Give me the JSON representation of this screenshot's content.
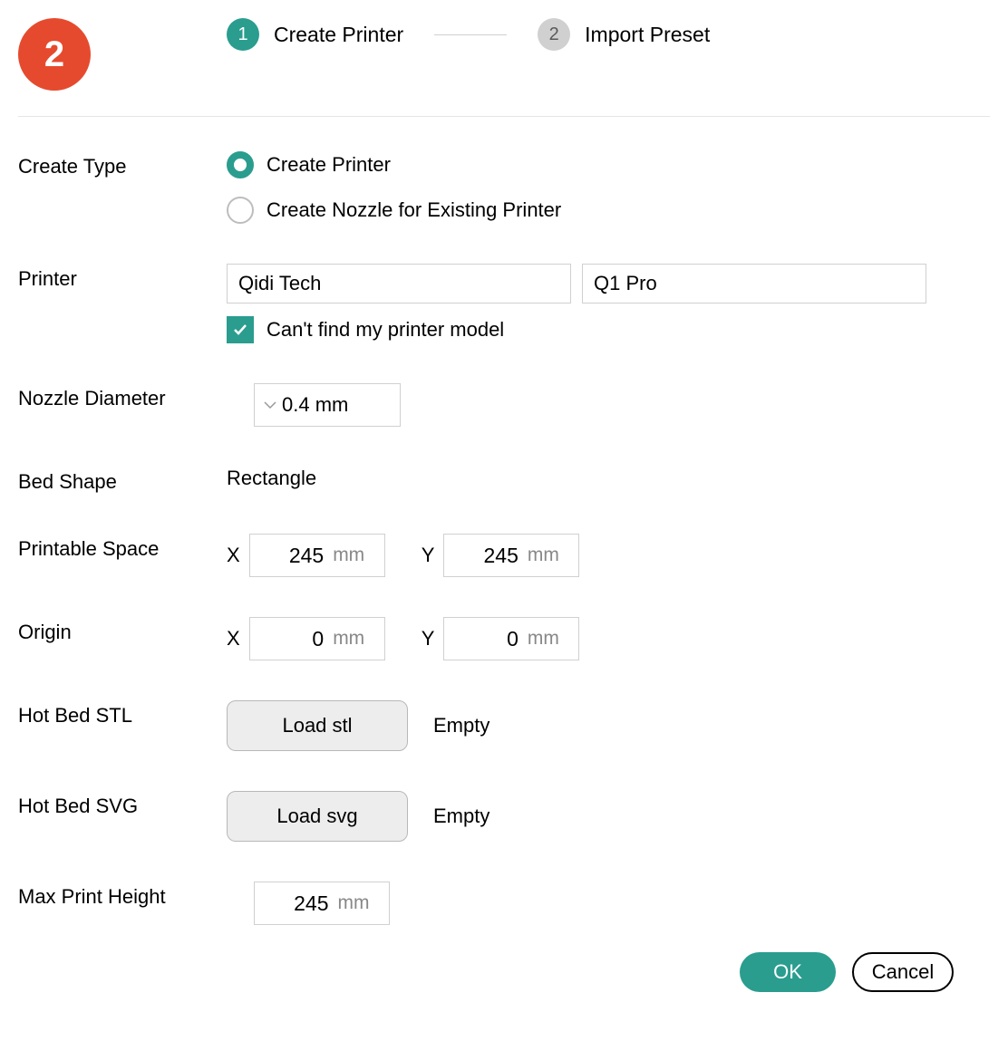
{
  "badge": "2",
  "steps": {
    "step1": {
      "num": "1",
      "label": "Create Printer"
    },
    "step2": {
      "num": "2",
      "label": "Import Preset"
    }
  },
  "labels": {
    "create_type": "Create Type",
    "printer": "Printer",
    "nozzle_diameter": "Nozzle Diameter",
    "bed_shape": "Bed Shape",
    "printable_space": "Printable Space",
    "origin": "Origin",
    "hot_bed_stl": "Hot Bed STL",
    "hot_bed_svg": "Hot Bed SVG",
    "max_print_height": "Max Print Height"
  },
  "create_type": {
    "create_printer": "Create Printer",
    "create_nozzle": "Create Nozzle for Existing Printer"
  },
  "printer": {
    "brand": "Qidi Tech",
    "model": "Q1 Pro",
    "cant_find": "Can't find my printer model"
  },
  "nozzle": {
    "value": "0.4 mm"
  },
  "bed_shape": "Rectangle",
  "printable_space": {
    "x_label": "X",
    "x_value": "245",
    "y_label": "Y",
    "y_value": "245",
    "unit": "mm"
  },
  "origin": {
    "x_label": "X",
    "x_value": "0",
    "y_label": "Y",
    "y_value": "0",
    "unit": "mm"
  },
  "hot_bed_stl": {
    "button": "Load stl",
    "status": "Empty"
  },
  "hot_bed_svg": {
    "button": "Load svg",
    "status": "Empty"
  },
  "max_print_height": {
    "value": "245",
    "unit": "mm"
  },
  "footer": {
    "ok": "OK",
    "cancel": "Cancel"
  }
}
